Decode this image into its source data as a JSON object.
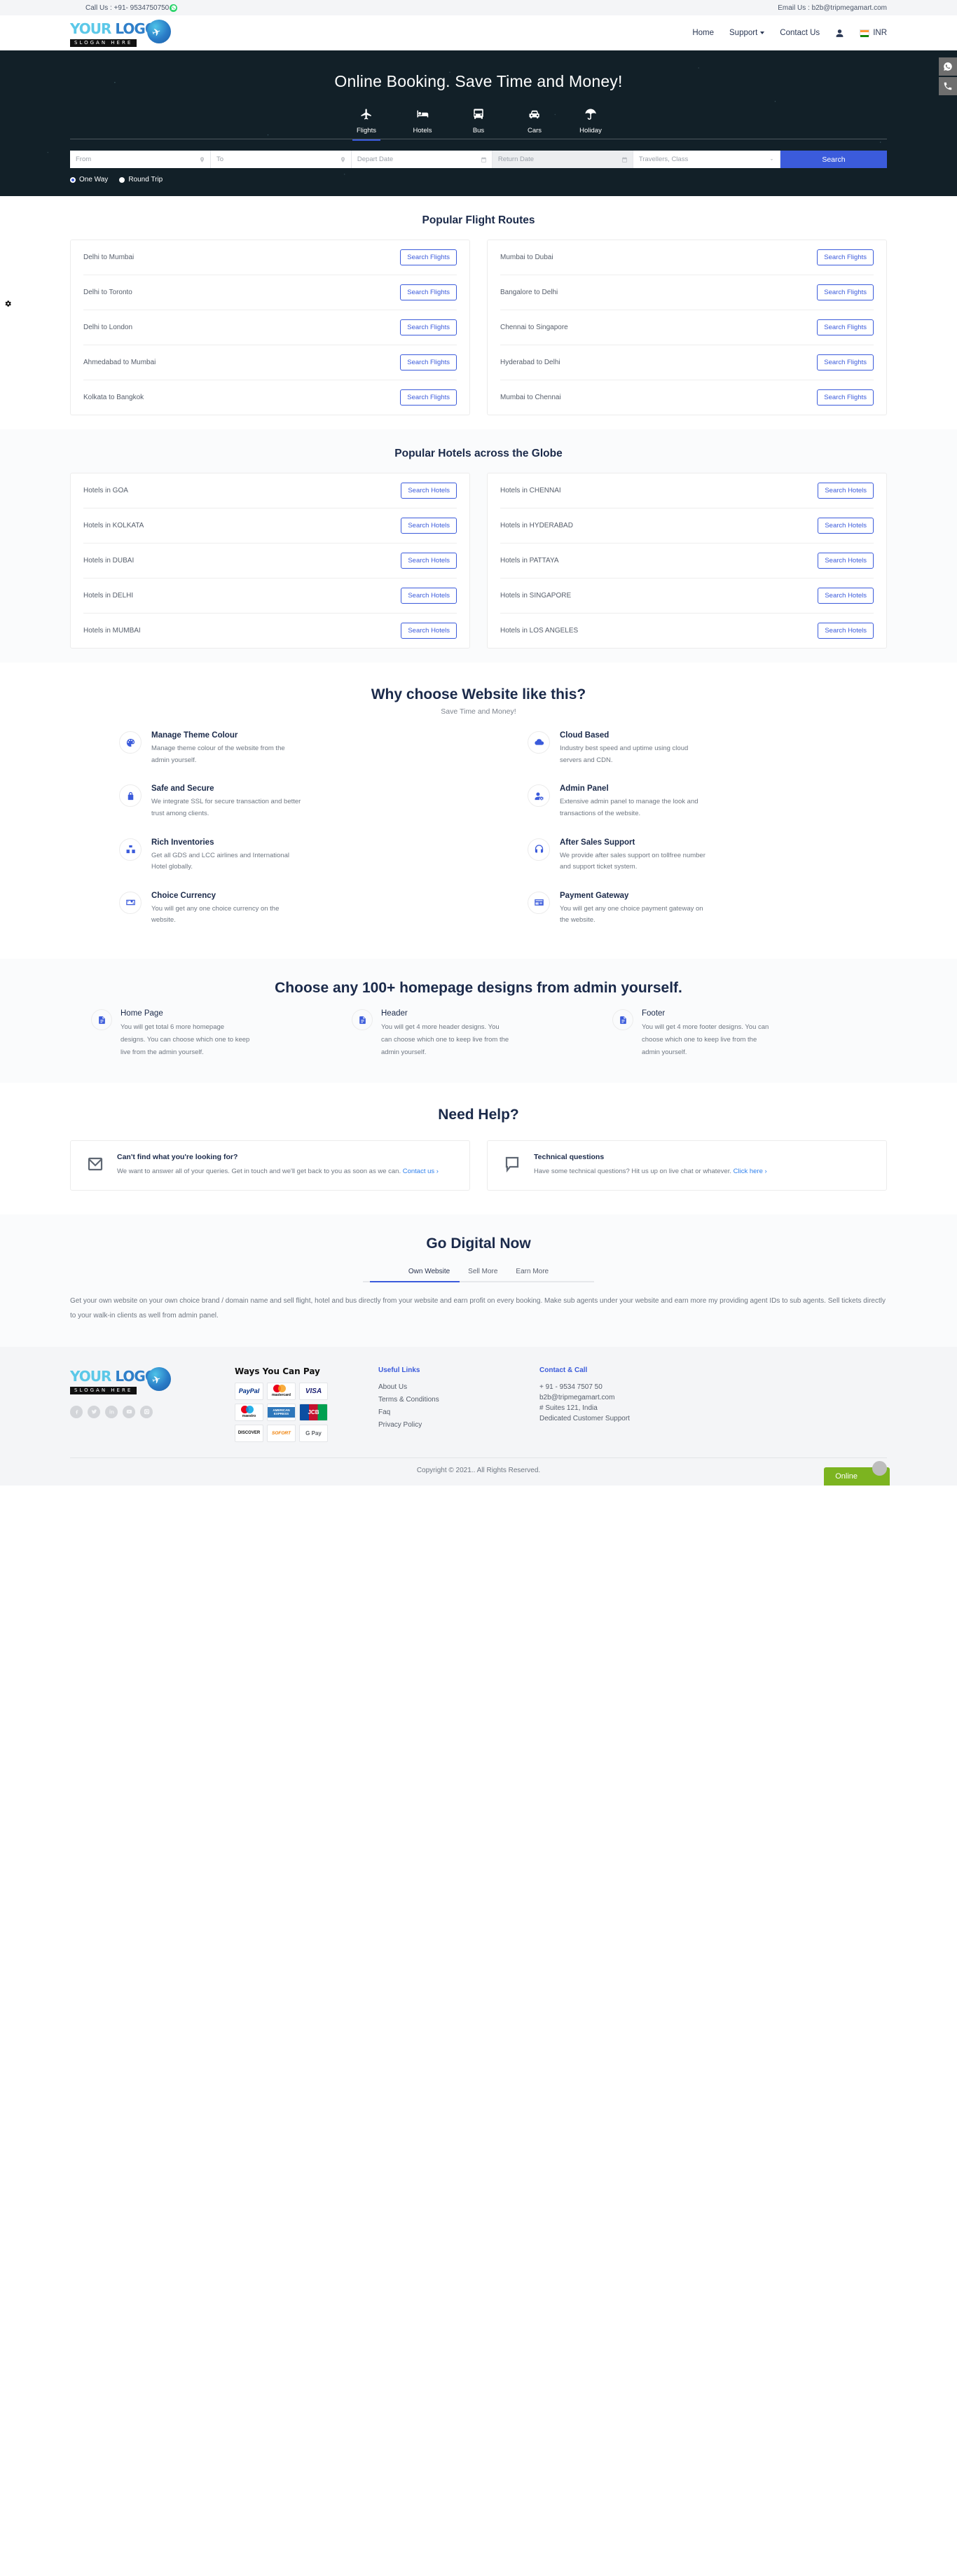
{
  "topbar": {
    "call_label": "Call Us : +91- 9534750750",
    "email_label": "Email Us : b2b@tripmegamart.com",
    "whatsapp_icon": "whatsapp-icon"
  },
  "header": {
    "logo": {
      "your": "YOUR",
      "logo": "LOGO",
      "slogan": "SLOGAN HERE"
    },
    "nav": [
      {
        "label": "Home",
        "has_caret": false
      },
      {
        "label": "Support",
        "has_caret": true
      },
      {
        "label": "Contact Us",
        "has_caret": false
      }
    ],
    "account_icon": "user-icon",
    "currency": {
      "flag": "india-flag-icon",
      "label": "INR"
    }
  },
  "hero": {
    "title": "Online Booking. Save Time and Money!",
    "tabs": [
      {
        "label": "Flights",
        "icon": "plane-icon",
        "active": true
      },
      {
        "label": "Hotels",
        "icon": "bed-icon",
        "active": false
      },
      {
        "label": "Bus",
        "icon": "bus-icon",
        "active": false
      },
      {
        "label": "Cars",
        "icon": "car-icon",
        "active": false
      },
      {
        "label": "Holiday",
        "icon": "umbrella-icon",
        "active": false
      }
    ],
    "search": {
      "from_placeholder": "From",
      "to_placeholder": "To",
      "depart_placeholder": "Depart Date",
      "return_placeholder": "Return Date",
      "travellers_placeholder": "Travellers, Class",
      "search_label": "Search"
    },
    "trip_types": [
      {
        "label": "One Way",
        "selected": true
      },
      {
        "label": "Round Trip",
        "selected": false
      }
    ],
    "side_tools": [
      {
        "icon": "whatsapp-icon"
      },
      {
        "icon": "phone-icon"
      }
    ],
    "settings_tab_icon": "gear-icon"
  },
  "flight_routes": {
    "title": "Popular Flight Routes",
    "button_label": "Search Flights",
    "left": [
      "Delhi to Mumbai",
      "Delhi to Toronto",
      "Delhi to London",
      "Ahmedabad to Mumbai",
      "Kolkata to Bangkok"
    ],
    "right": [
      "Mumbai to Dubai",
      "Bangalore to Delhi",
      "Chennai to Singapore",
      "Hyderabad to Delhi",
      "Mumbai to Chennai"
    ]
  },
  "hotels": {
    "title": "Popular Hotels across the Globe",
    "button_label": "Search Hotels",
    "left": [
      "Hotels in GOA",
      "Hotels in KOLKATA",
      "Hotels in DUBAI",
      "Hotels in DELHI",
      "Hotels in MUMBAI"
    ],
    "right": [
      "Hotels in CHENNAI",
      "Hotels in HYDERABAD",
      "Hotels in PATTAYA",
      "Hotels in SINGAPORE",
      "Hotels in LOS ANGELES"
    ]
  },
  "why": {
    "title": "Why choose Website like this?",
    "subtitle": "Save Time and Money!",
    "items": [
      {
        "icon": "palette-icon",
        "title": "Manage Theme Colour",
        "desc": "Manage theme colour of the website from the admin yourself."
      },
      {
        "icon": "cloud-icon",
        "title": "Cloud Based",
        "desc": "Industry best speed and uptime using cloud servers and CDN."
      },
      {
        "icon": "lock-icon",
        "title": "Safe and Secure",
        "desc": "We integrate SSL for secure transaction and better trust among clients."
      },
      {
        "icon": "user-gear-icon",
        "title": "Admin Panel",
        "desc": "Extensive admin panel to manage the look and transactions of the website."
      },
      {
        "icon": "boxes-icon",
        "title": "Rich Inventories",
        "desc": "Get all GDS and LCC airlines and International Hotel globally."
      },
      {
        "icon": "headset-icon",
        "title": "After Sales Support",
        "desc": "We provide after sales support on tollfree number and support ticket system."
      },
      {
        "icon": "money-icon",
        "title": "Choice Currency",
        "desc": "You will get any one choice currency on the website."
      },
      {
        "icon": "credit-card-icon",
        "title": "Payment Gateway",
        "desc": "You will get any one choice payment gateway on the website."
      }
    ]
  },
  "designs": {
    "title": "Choose any 100+ homepage designs from admin yourself.",
    "items": [
      {
        "icon": "document-icon",
        "title": "Home Page",
        "desc": "You will get total 6 more homepage designs. You can choose which one to keep live from the admin yourself."
      },
      {
        "icon": "document-icon",
        "title": "Header",
        "desc": "You will get 4 more header designs. You can choose which one to keep live from the admin yourself."
      },
      {
        "icon": "document-icon",
        "title": "Footer",
        "desc": "You will get 4 more footer designs. You can choose which one to keep live from the admin yourself."
      }
    ]
  },
  "help": {
    "title": "Need Help?",
    "cards": [
      {
        "icon": "envelope-icon",
        "title": "Can't find what you're looking for?",
        "desc": "We want to answer all of your queries. Get in touch and we'll get back to you as soon as we can.",
        "link": "Contact us ›"
      },
      {
        "icon": "chat-bubble-icon",
        "title": "Technical questions",
        "desc": "Have some technical questions? Hit us up on live chat or whatever.",
        "link": "Click here ›"
      }
    ]
  },
  "go_digital": {
    "title": "Go Digital Now",
    "tabs": [
      {
        "label": "Own Website",
        "active": true
      },
      {
        "label": "Sell More",
        "active": false
      },
      {
        "label": "Earn More",
        "active": false
      }
    ],
    "body": "Get your own website on your own choice brand / domain name and sell flight, hotel and bus directly from your website and earn profit on every booking. Make sub agents under your website and earn more my providing agent IDs to sub agents. Sell tickets directly to your walk-in clients as well from admin panel."
  },
  "footer": {
    "logo": {
      "your": "YOUR",
      "logo": "LOGO",
      "slogan": "SLOGAN HERE"
    },
    "socials": [
      "facebook-icon",
      "twitter-icon",
      "linkedin-icon",
      "youtube-icon",
      "instagram-icon"
    ],
    "pay": {
      "title": "Ways You Can Pay",
      "methods": [
        "PayPal",
        "mastercard",
        "VISA",
        "maestro",
        "AMERICAN EXPRESS",
        "JCB",
        "DISCOVER",
        "SOFORT",
        "G Pay"
      ]
    },
    "useful_links": {
      "title": "Useful Links",
      "items": [
        "About Us",
        "Terms & Conditions",
        "Faq",
        "Privacy Policy"
      ]
    },
    "contact": {
      "title": "Contact & Call",
      "lines": [
        "+ 91 - 9534 7507 50",
        "b2b@tripmegamart.com",
        "# Suites 121, India",
        "Dedicated Customer Support"
      ]
    },
    "copyright": "Copyright © 2021.. All Rights Reserved.",
    "chat_chip": "Online"
  }
}
